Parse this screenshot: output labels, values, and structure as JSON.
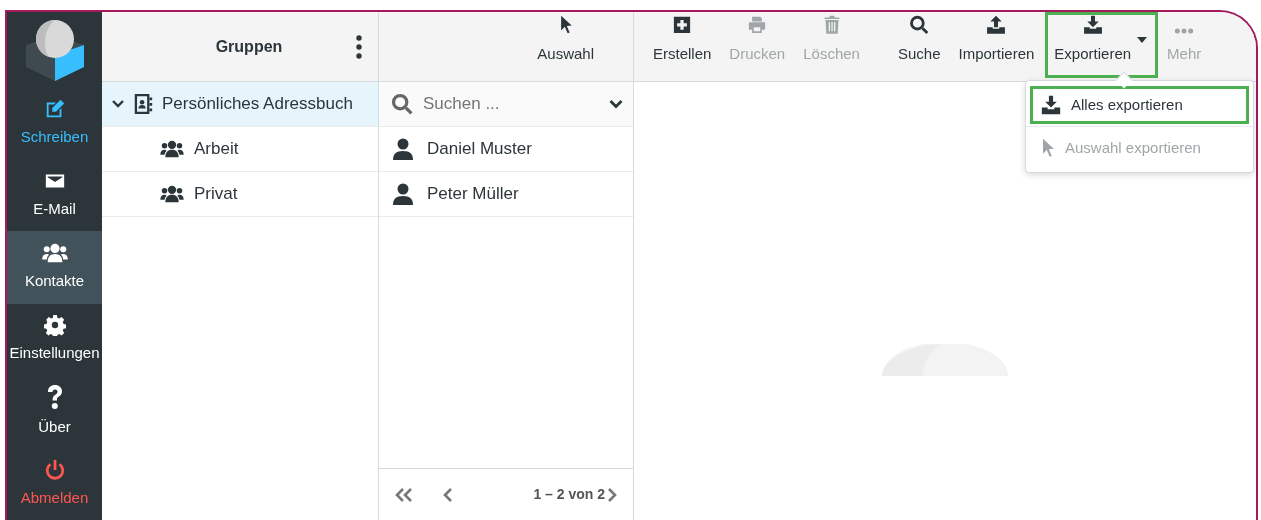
{
  "sidebar": {
    "items": [
      {
        "label": "Schreiben",
        "kind": "compose",
        "selected": false
      },
      {
        "label": "E-Mail",
        "kind": "mail",
        "selected": false
      },
      {
        "label": "Kontakte",
        "kind": "contacts",
        "selected": true
      },
      {
        "label": "Einstellungen",
        "kind": "settings",
        "selected": false
      },
      {
        "label": "Über",
        "kind": "about",
        "selected": false
      },
      {
        "label": "Abmelden",
        "kind": "logout",
        "selected": false
      }
    ]
  },
  "groups": {
    "title": "Gruppen",
    "tree": [
      {
        "label": "Persönliches Adressbuch",
        "kind": "addressbook",
        "expanded": true,
        "selected": true,
        "children": [
          {
            "label": "Arbeit",
            "kind": "group",
            "selected": false
          },
          {
            "label": "Privat",
            "kind": "group",
            "selected": false
          }
        ]
      }
    ]
  },
  "contacts": {
    "toolbar_button": "Auswahl",
    "search": {
      "placeholder": "Suchen ..."
    },
    "rows": [
      {
        "name": "Daniel Muster",
        "selected": false
      },
      {
        "name": "Peter Müller",
        "selected": false
      }
    ],
    "pagination": "1 – 2 von 2"
  },
  "toolbar": {
    "buttons": [
      {
        "label": "Erstellen",
        "kind": "create",
        "disabled": false,
        "highlighted": false
      },
      {
        "label": "Drucken",
        "kind": "print",
        "disabled": true,
        "highlighted": false
      },
      {
        "label": "Löschen",
        "kind": "delete",
        "disabled": true,
        "highlighted": false
      },
      {
        "label": "Suche",
        "kind": "search",
        "disabled": false,
        "highlighted": false
      },
      {
        "label": "Importieren",
        "kind": "import",
        "disabled": false,
        "highlighted": false
      },
      {
        "label": "Exportieren",
        "kind": "export",
        "disabled": false,
        "highlighted": true,
        "dropdown": true
      },
      {
        "label": "Mehr",
        "kind": "more",
        "disabled": true,
        "highlighted": false
      }
    ]
  },
  "export_menu": {
    "items": [
      {
        "label": "Alles exportieren",
        "kind": "export",
        "disabled": false,
        "highlighted": true
      },
      {
        "label": "Auswahl exportieren",
        "kind": "select",
        "disabled": true,
        "highlighted": false
      }
    ]
  }
}
